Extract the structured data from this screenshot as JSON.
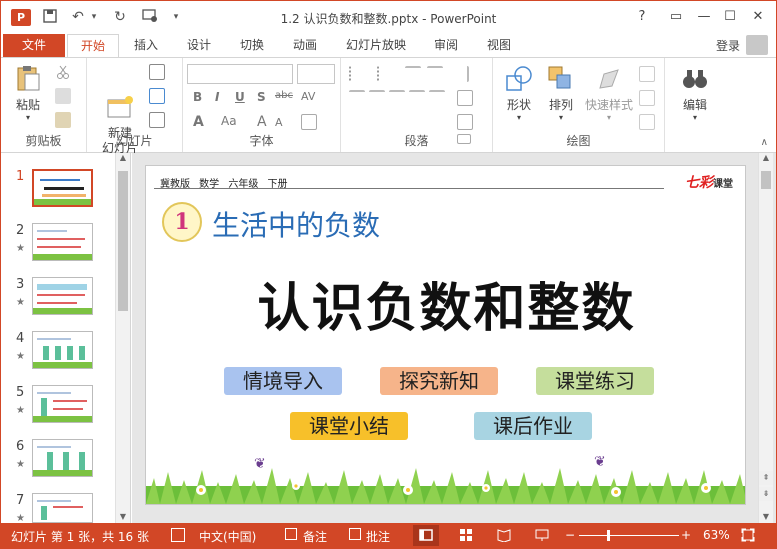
{
  "window": {
    "title": "1.2 认识负数和整数.pptx - PowerPoint",
    "app_logo": "P",
    "help": "?",
    "controls": [
      "▭",
      "—",
      "☐",
      "✕"
    ]
  },
  "tabs": {
    "file": "文件",
    "items": [
      "开始",
      "插入",
      "设计",
      "切换",
      "动画",
      "幻灯片放映",
      "审阅",
      "视图"
    ],
    "active": "开始",
    "login": "登录"
  },
  "ribbon": {
    "clipboard": {
      "paste": "粘贴",
      "label": "剪贴板"
    },
    "slides": {
      "new_slide": "新建\n幻灯片",
      "label": "幻灯片"
    },
    "font": {
      "label": "字体",
      "bold": "B",
      "italic": "I",
      "underline": "U",
      "shadow": "S",
      "strike": "abc",
      "spacing": "AV",
      "aa": "Aa",
      "font_color": "A",
      "grow": "A",
      "shrink": "A"
    },
    "paragraph": {
      "label": "段落"
    },
    "drawing": {
      "shapes": "形状",
      "arrange": "排列",
      "quick_styles": "快速样式",
      "label": "绘图"
    },
    "editing": {
      "edit": "编辑"
    }
  },
  "thumbnails": [
    {
      "num": "1",
      "star": "",
      "selected": true
    },
    {
      "num": "2",
      "star": "★",
      "selected": false
    },
    {
      "num": "3",
      "star": "★",
      "selected": false
    },
    {
      "num": "4",
      "star": "★",
      "selected": false
    },
    {
      "num": "5",
      "star": "★",
      "selected": false
    },
    {
      "num": "6",
      "star": "★",
      "selected": false
    },
    {
      "num": "7",
      "star": "★",
      "selected": false
    }
  ],
  "slide": {
    "header": "冀教版 数学 六年级 下册",
    "brand_main": "七彩",
    "brand_sub": "课堂",
    "circle": "1",
    "section": "生活中的负数",
    "title": "认识负数和整数",
    "pills": [
      {
        "text": "情境导入",
        "color": "#a9c3ef"
      },
      {
        "text": "探究新知",
        "color": "#f6b48a"
      },
      {
        "text": "课堂练习",
        "color": "#c5de9c"
      },
      {
        "text": "课堂小结",
        "color": "#f7c02a"
      },
      {
        "text": "课后作业",
        "color": "#a8d4e2"
      }
    ]
  },
  "status": {
    "slide_info": "幻灯片 第 1 张，共 16 张",
    "language": "中文(中国)",
    "notes": "备注",
    "comments": "批注",
    "zoom": "63%",
    "zoom_minus": "−",
    "zoom_plus": "+"
  }
}
